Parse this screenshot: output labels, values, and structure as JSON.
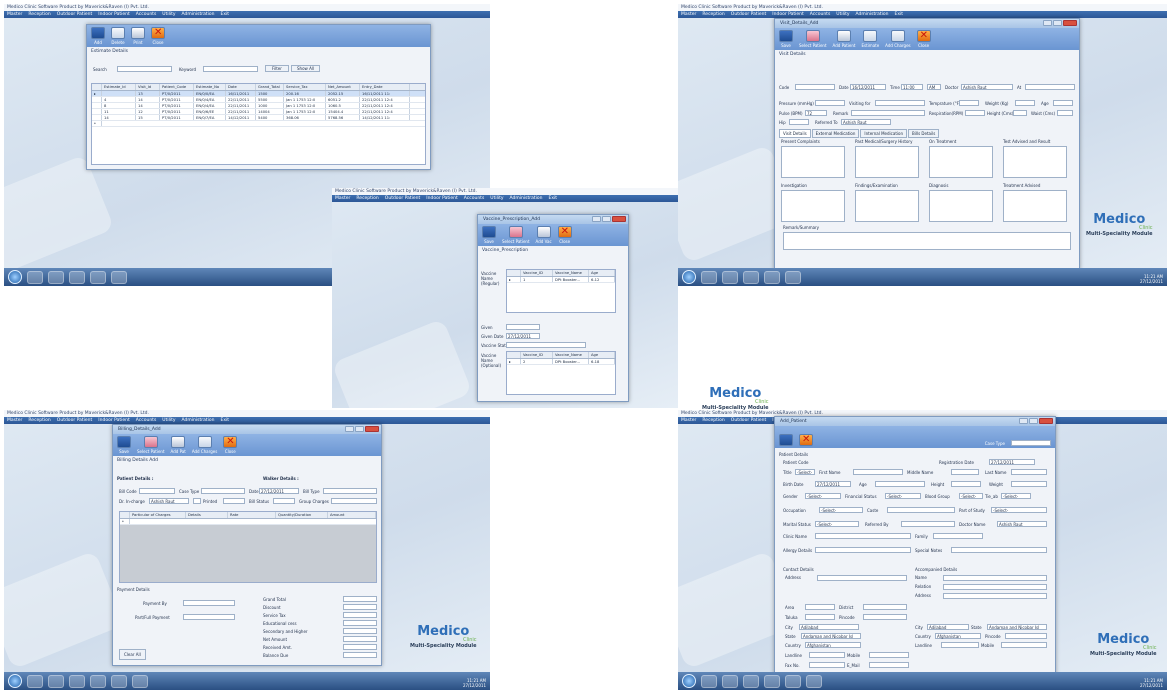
{
  "app_title": "Medico Clinic Software  Product by Maverick&Raven (I) Pvt. Ltd.",
  "menu": [
    "Master",
    "Reception",
    "Outdoor Patient",
    "Indoor Patient",
    "Accounts",
    "Utility",
    "Administration",
    "Exit"
  ],
  "brand": {
    "name": "Medico",
    "sub": "Clinic",
    "module": "Multi-Speciality Module"
  },
  "clock": {
    "time": "11:21 AM",
    "date": "27/12/2011"
  },
  "estimate": {
    "toolbar": [
      "Add",
      "Delete",
      "Print",
      "Close"
    ],
    "section": "Estimate Details",
    "search_label": "Search",
    "keyword_label": "Keyword",
    "filter_btn": "Filter",
    "show_all_btn": "Show All",
    "columns": [
      "Estimate_Id",
      "Visit_Id",
      "Patient_Code",
      "Estimate_No",
      "Date",
      "Grand_Total",
      "Service_Tax",
      "Net_Amount",
      "Entry_Date"
    ],
    "rows": [
      [
        "",
        "13",
        "PT/0/2011",
        "EN/0/0/EA",
        "16/11/2011",
        "1500",
        "200.16",
        "2052.15",
        "16/11/2011 11:"
      ],
      [
        "4",
        "14",
        "PT/0/2011",
        "EN/0/4/EA",
        "22/11/2011",
        "5500",
        "Jan 1 1753 12:0",
        "6051.2",
        "22/11/2011 12:4"
      ],
      [
        "8",
        "14",
        "PT/0/2011",
        "EN/0/4/EA",
        "22/11/2011",
        "1000",
        "Jan 1 1753 12:0",
        "1060.5",
        "22/11/2011 12:4"
      ],
      [
        "11",
        "12",
        "PT/0/2011",
        "EN/0/6/EE",
        "22/11/2011",
        "14004",
        "Jan 1 1753 12:0",
        "15404.4",
        "22/11/2011 12:4"
      ],
      [
        "14",
        "15",
        "PT/0/2011",
        "EN/0/7/EA",
        "14/12/2011",
        "5400",
        "368.06",
        "5768.56",
        "14/12/2011 11:"
      ]
    ]
  },
  "visit": {
    "window_title": "Visit_Details_Add",
    "menu": "Menu",
    "toolbar": [
      "Save",
      "Select Patient",
      "Add Patient",
      "Estimate",
      "Add Charges",
      "Close"
    ],
    "section": "Visit Details",
    "code": "Code",
    "date_label": "Date",
    "date_val": "16/12/2011",
    "time_label": "Time",
    "time_val": "11:00",
    "ampm": "AM",
    "doctor_label": "Doctor",
    "doctor_val": "Ashish Raut",
    "at_label": "At",
    "pressure": "Pressure (mmHg)",
    "visiting": "Visiting for",
    "temp": "Temprature (°F)",
    "weight": "Weight (Kg)",
    "age": "Age",
    "pulse": "Pulse (BPM)",
    "pulse_val": "72",
    "remark": "Remark",
    "resp": "Respiration(RPM)",
    "height": "Height (Cms)",
    "waist": "Waist (Cms)",
    "hip": "Hip",
    "referred": "Referred To",
    "referred_val": "Ashish Raut",
    "tabs": [
      "Visit Details",
      "External Medication",
      "Internal Medication",
      "Bills Details"
    ],
    "boxes": [
      "Present Complaints",
      "Past Medical/Surgery History",
      "On Treatment",
      "Test Advised and Result",
      "Investigation",
      "Findings/Examination",
      "Diagnosis",
      "Treatment Advised"
    ],
    "remark_summary": "Remark/Summary"
  },
  "vaccine": {
    "window_title": "Vaccine_Prescription_Add",
    "toolbar": [
      "Save",
      "Select Patient",
      "Add Vac",
      "Close"
    ],
    "section": "Vaccine_Prescription",
    "regular_label": "Vaccine Name (Regular)",
    "optional_label": "Vaccine Name (Optional)",
    "cols": [
      "Vaccine_ID",
      "Vaccine_Name",
      "Age"
    ],
    "regular_row": [
      "1",
      "DPt Booster...",
      "6-12"
    ],
    "optional_row": [
      "2",
      "DPt Booster...",
      "6-18"
    ],
    "given": "Given",
    "given_date": "Given Date",
    "given_date_val": "27/12/2011",
    "status": "Vaccine Status"
  },
  "billing": {
    "window_title": "Billing_Details_Add",
    "toolbar": [
      "Save",
      "Select Patient",
      "Add Pat",
      "Add Charges",
      "Close"
    ],
    "section": "Billing Details Add",
    "patient_details": "Patient Details :",
    "walker_details": "Walker Details :",
    "bill_code": "Bill Code",
    "case_type": "Case Type",
    "date": "Date",
    "date_val": "27/12/2011",
    "bill_type": "Bill Type",
    "dr_incharge": "Dr. In-charge",
    "dr_val": "Ashish Raut",
    "printed": "Printed",
    "bill_status": "Bill Status",
    "group_charges": "Group Charges",
    "cols": [
      "Particular of Charges",
      "Details",
      "Rate",
      "Quantity/Duration",
      "Amount"
    ],
    "payment": "Payment Details",
    "payment_by": "Payment By",
    "part_full": "Part/Full Payment",
    "totals": [
      "Grand Total",
      "Discount",
      "Service Tax",
      "Educational cess",
      "Secondary and Higher",
      "Net Amount",
      "Received Amt.",
      "Balance Due"
    ],
    "clear": "Clear All"
  },
  "patient": {
    "window_title": "Add_Patient",
    "menu": "Menu",
    "case_type": "Case Type",
    "section": "Patient Details",
    "patient_code": "Patient Code",
    "reg_date": "Registration Date",
    "reg_date_val": "27/12/2011",
    "title": "Title",
    "select": "-Select-",
    "first_name": "First Name",
    "middle": "Middle Name",
    "last": "Last Name",
    "birth_date": "Birth Date",
    "birth_val": "27/12/2011",
    "age": "Age",
    "height": "Height",
    "weight": "Weight",
    "gender": "Gender",
    "fin": "Financial Status",
    "blood": "Blood Group",
    "tie": "Tie_ab",
    "occupation": "Occupation",
    "caste": "Caste",
    "part_study": "Part of Study",
    "marital": "Marital Status",
    "referred_by": "Referred By",
    "doctor_name": "Doctor Name",
    "doctor_val": "Ashish Raut",
    "clinic_name": "Clinic Name",
    "family": "Family",
    "allergy": "Allergy Details",
    "special": "Special Notes",
    "contact": "Contact Details",
    "accompanied": "Accompanied Details",
    "address": "Address",
    "name": "Name",
    "relation": "Relation",
    "area": "Area",
    "district": "District",
    "taluka": "Taluka",
    "pincode": "Pincode",
    "city": "City",
    "city_val": "Adilabad",
    "state": "State",
    "state_val": "Andaman and Nicobar Isl",
    "country": "Country",
    "country_val": "Afghanistan",
    "landline": "Landline",
    "mobile": "Mobile",
    "fax": "Fax No.",
    "email": "E_Mail"
  }
}
